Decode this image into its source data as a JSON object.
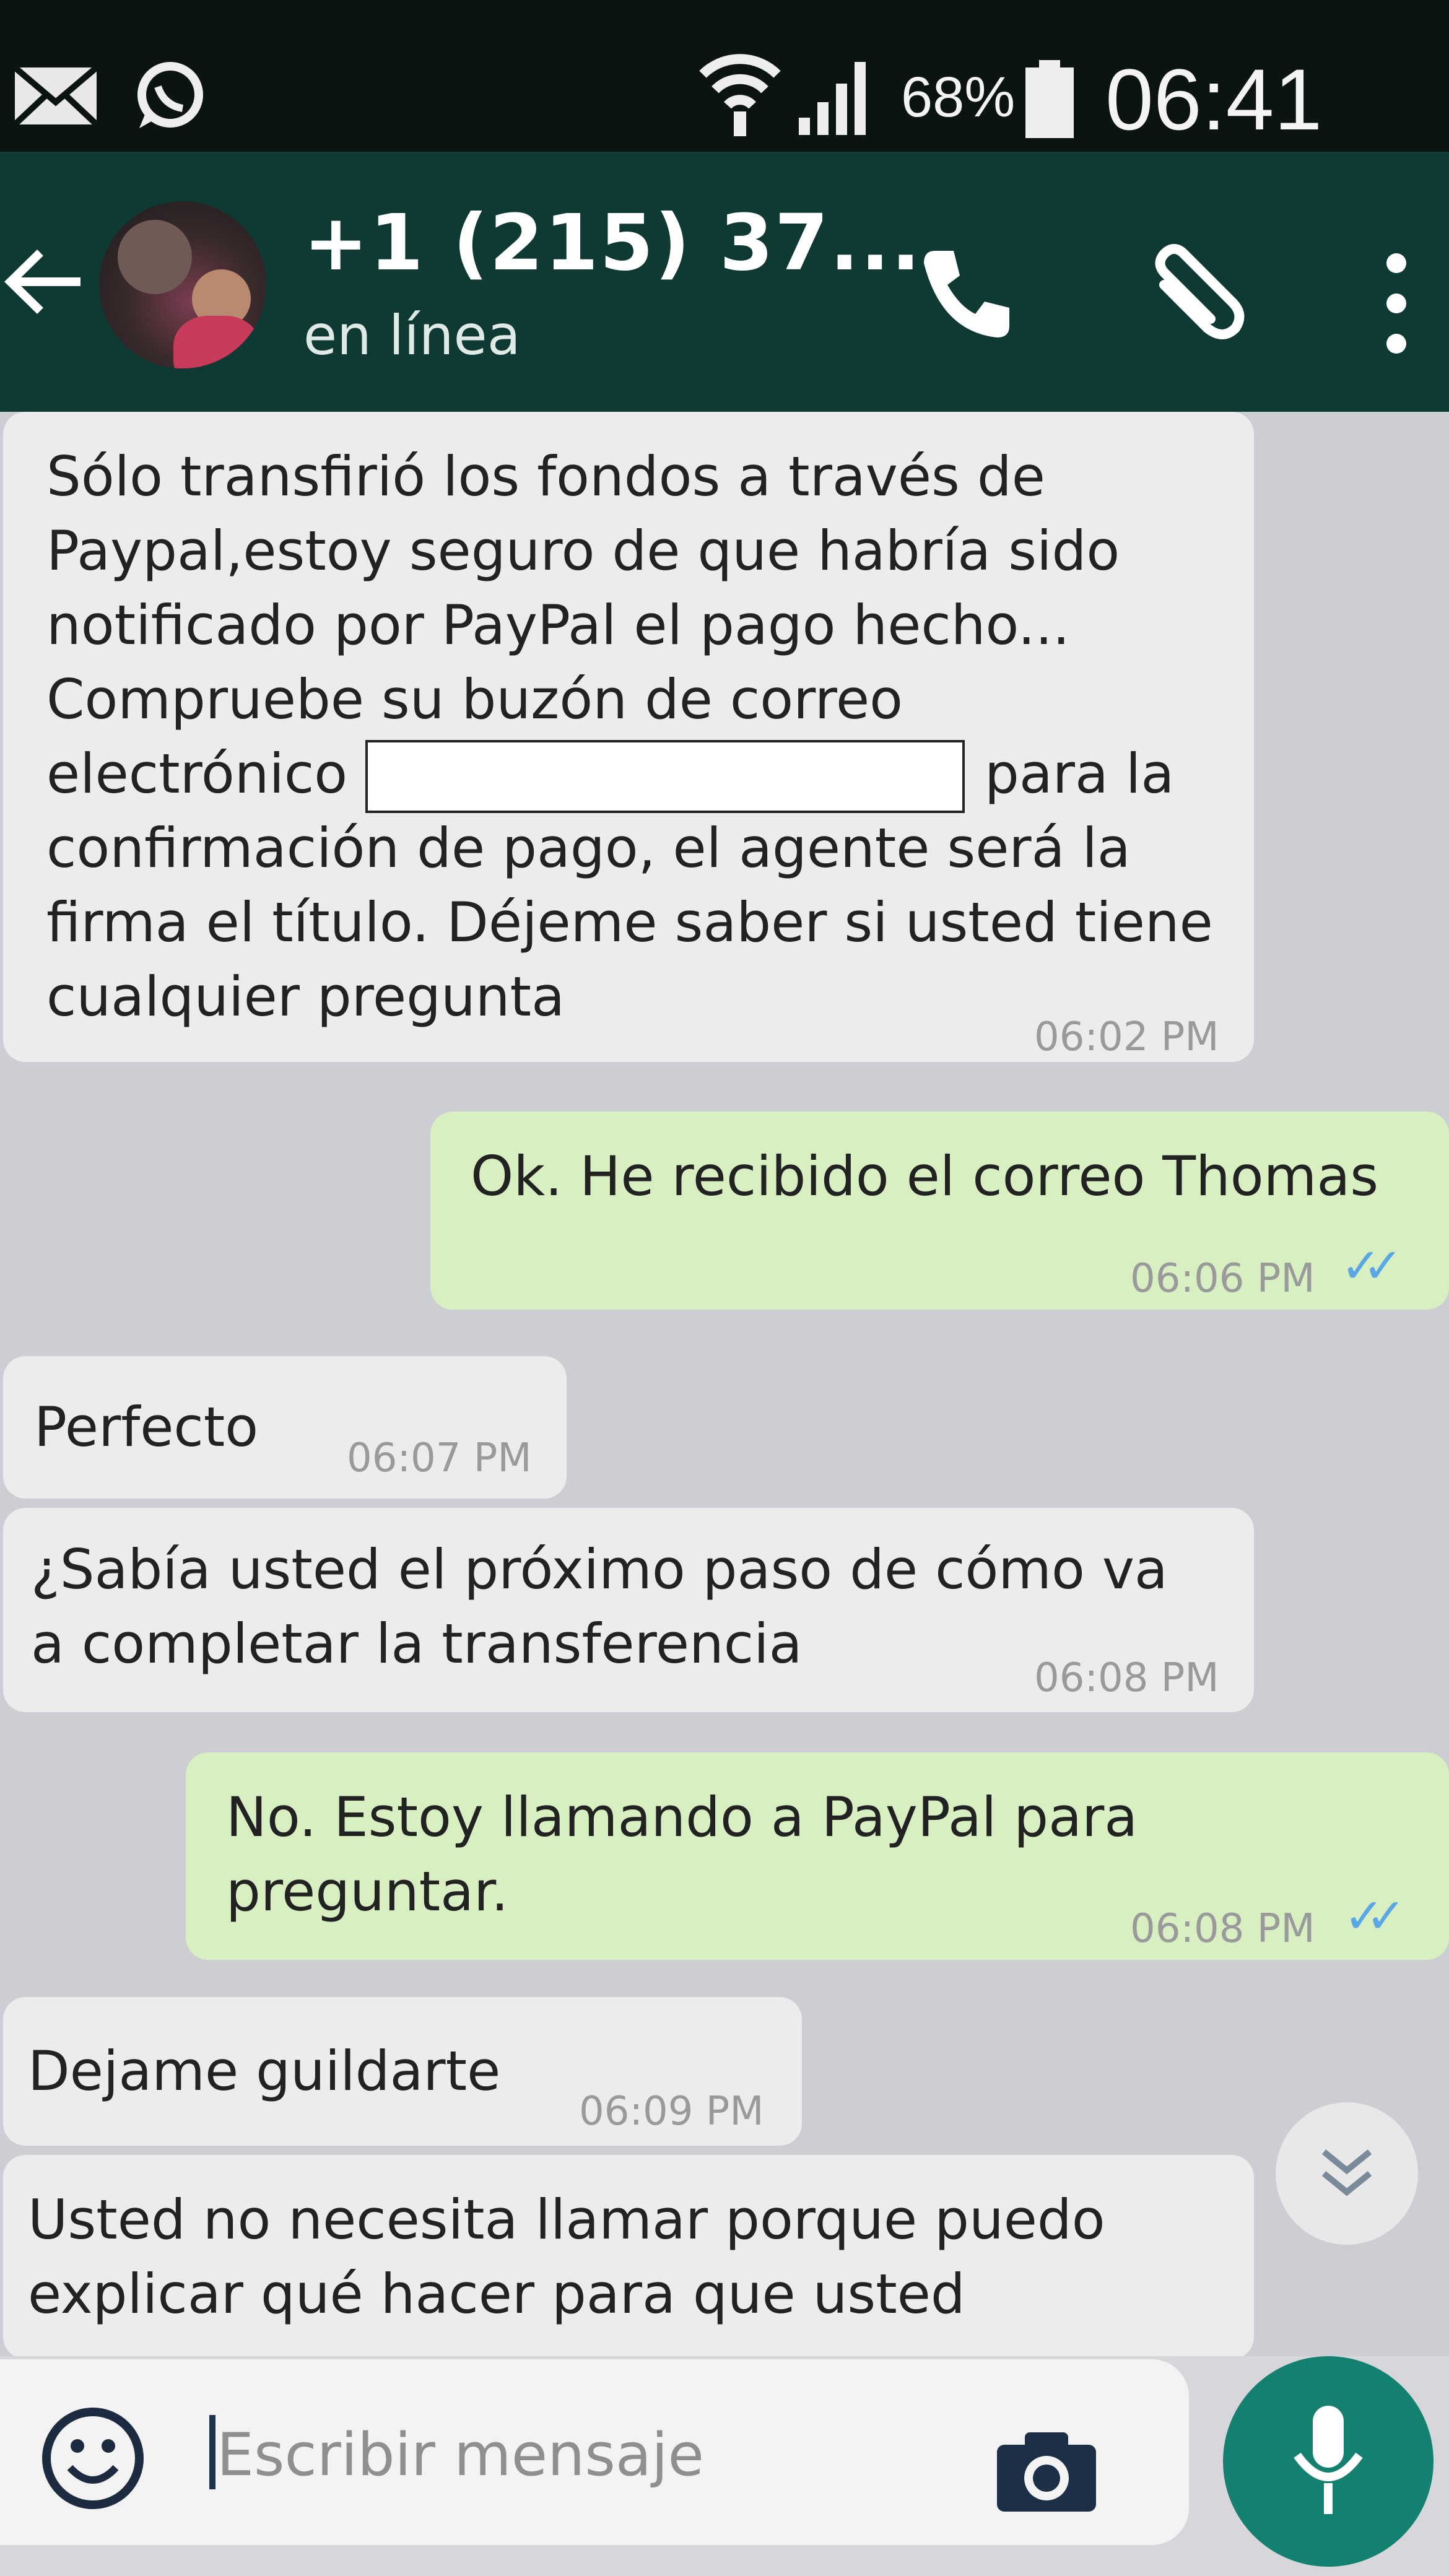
{
  "status_bar": {
    "battery_percent": "68%",
    "time": "06:41 PM",
    "icons": [
      "mail-icon",
      "whatsapp-icon",
      "wifi-icon",
      "signal-icon",
      "battery-icon"
    ]
  },
  "header": {
    "contact_name": "+1 (215) 37...",
    "status": "en línea",
    "icons": [
      "back-arrow-icon",
      "phone-icon",
      "paperclip-icon",
      "more-vert-icon"
    ]
  },
  "messages": [
    {
      "direction": "incoming",
      "lines": [
        "Sólo transfirió los fondos a través de",
        "Paypal,estoy seguro de que habría sido",
        "notificado por PayPal el pago hecho...",
        "Compruebe su buzón de correo",
        "electrónico",
        "confirmación de pago, el agente será la",
        "firma el título. Déjeme saber si usted tiene",
        "cualquier pregunta"
      ],
      "redacted_suffix": "para la",
      "time": "06:02 PM"
    },
    {
      "direction": "outgoing",
      "text": "Ok. He recibido el correo Thomas",
      "time": "06:06 PM",
      "read": true
    },
    {
      "direction": "incoming",
      "text": "Perfecto",
      "time": "06:07 PM"
    },
    {
      "direction": "incoming",
      "lines": [
        "¿Sabía usted el próximo paso de cómo va",
        "a completar la transferencia"
      ],
      "time": "06:08 PM"
    },
    {
      "direction": "outgoing",
      "lines": [
        "No. Estoy llamando a PayPal para",
        "preguntar."
      ],
      "time": "06:08 PM",
      "read": true
    },
    {
      "direction": "incoming",
      "text": "Dejame guildarte",
      "time": "06:09 PM"
    },
    {
      "direction": "incoming",
      "lines": [
        "Usted no necesita llamar porque puedo",
        "explicar qué hacer para que usted"
      ]
    }
  ],
  "composer": {
    "placeholder": "Escribir mensaje",
    "icons": [
      "emoji-icon",
      "camera-icon",
      "microphone-icon"
    ]
  },
  "colors": {
    "app_bar": "#0e3a33",
    "incoming_bubble": "#ececec",
    "outgoing_bubble": "#d7efc1",
    "read_ticks": "#5aa7e6",
    "mic_button": "#14806f"
  }
}
